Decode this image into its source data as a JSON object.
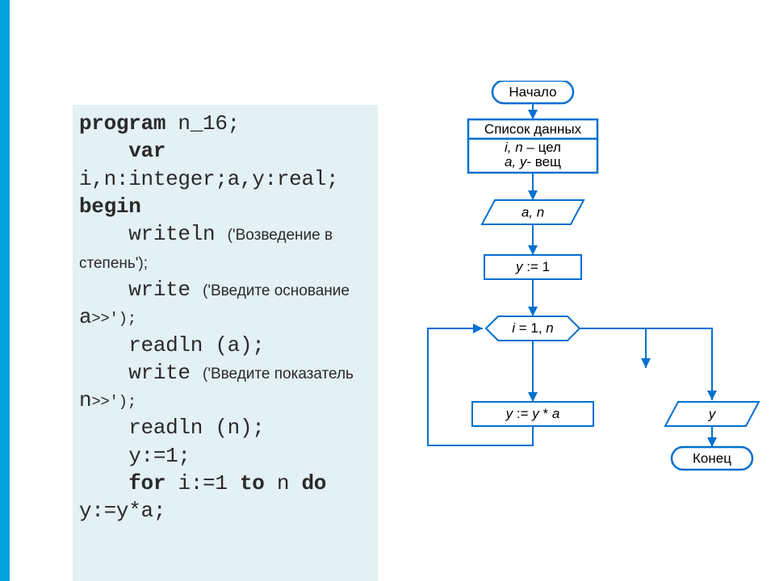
{
  "code": {
    "l1_kw": "program",
    "l1_rest": " n_16;",
    "l2_kw": "    var",
    "l3": "i,n:integer;a,y:real;",
    "l4_kw": "begin",
    "l5a": "    writeln ",
    "l5b": "('Возведение в степень');",
    "l6a": "    write ",
    "l6b": "('Введите основание ",
    "l6c": "a",
    "l6d": ">>');",
    "l7": "    readln (a);",
    "l8a": "    write ",
    "l8b": "('Введите показатель ",
    "l8c": "n",
    "l8d": ">>');",
    "l9": "    readln (n);",
    "l10": "    y:=1;",
    "l11_a": "    ",
    "l11_kw1": "for",
    "l11_b": " i:=1 ",
    "l11_kw2": "to",
    "l11_c": " n ",
    "l11_kw3": "do",
    "l12": "y:=y*a;"
  },
  "flow": {
    "start": "Начало",
    "data_list_title": "Список данных",
    "data_list_l1_it": "i, n",
    "data_list_l1_rest": " – цел",
    "data_list_l2_it": "a, y",
    "data_list_l2_rest": "- вещ",
    "input": "a, n",
    "assign1": "y := 1",
    "loop": "i = 1, n",
    "body": "y := y * a",
    "output": "y",
    "end": "Конец"
  },
  "chart_data": {
    "type": "table",
    "description": "Pascal-style FOR-loop flowchart for computing y = a^n by repeated multiplication",
    "nodes": [
      {
        "id": "start",
        "shape": "terminator",
        "label": "Начало"
      },
      {
        "id": "decl",
        "shape": "rect-double",
        "label": "Список данных / i, n – цел / a, y – вещ"
      },
      {
        "id": "input",
        "shape": "parallelogram",
        "label": "a, n"
      },
      {
        "id": "init",
        "shape": "rect",
        "label": "y := 1"
      },
      {
        "id": "loop",
        "shape": "hexagon",
        "label": "i = 1, n"
      },
      {
        "id": "body",
        "shape": "rect",
        "label": "y := y * a"
      },
      {
        "id": "output",
        "shape": "parallelogram",
        "label": "y"
      },
      {
        "id": "end",
        "shape": "terminator",
        "label": "Конец"
      }
    ],
    "edges": [
      {
        "from": "start",
        "to": "decl"
      },
      {
        "from": "decl",
        "to": "input"
      },
      {
        "from": "input",
        "to": "init"
      },
      {
        "from": "init",
        "to": "loop"
      },
      {
        "from": "loop",
        "to": "body",
        "kind": "loop-body"
      },
      {
        "from": "body",
        "to": "loop",
        "kind": "loop-back"
      },
      {
        "from": "loop",
        "to": "output",
        "kind": "loop-exit"
      },
      {
        "from": "output",
        "to": "end"
      }
    ]
  }
}
